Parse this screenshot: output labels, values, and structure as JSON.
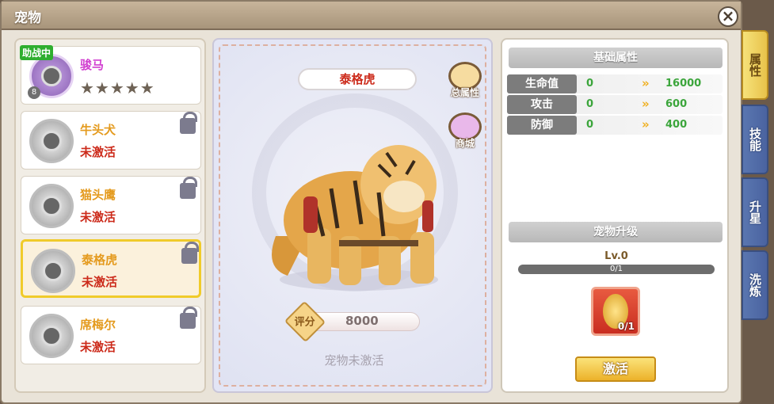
{
  "window": {
    "title": "宠物"
  },
  "pets": [
    {
      "name": "骏马",
      "state": "",
      "active": true,
      "assist_badge": "助战中",
      "level": "8",
      "stars": "★★★★★",
      "locked": false
    },
    {
      "name": "牛头犬",
      "state": "未激活",
      "active": false,
      "locked": true
    },
    {
      "name": "猫头鹰",
      "state": "未激活",
      "active": false,
      "locked": true
    },
    {
      "name": "泰格虎",
      "state": "未激活",
      "active": false,
      "locked": true,
      "selected": true
    },
    {
      "name": "席梅尔",
      "state": "未激活",
      "active": false,
      "locked": true
    }
  ],
  "center": {
    "pet_name": "泰格虎",
    "total_attr_label": "总属性",
    "shop_label": "商城",
    "score_label": "评分",
    "score_value": "8000",
    "inactive_text": "宠物未激活"
  },
  "base_attrs": {
    "header": "基础属性",
    "rows": [
      {
        "name": "生命值",
        "current": "0",
        "next": "16000"
      },
      {
        "name": "攻击",
        "current": "0",
        "next": "600"
      },
      {
        "name": "防御",
        "current": "0",
        "next": "400"
      }
    ]
  },
  "upgrade": {
    "header": "宠物升级",
    "level": "Lv.0",
    "exp_text": "0/1",
    "item_count": "0/1",
    "activate_label": "激活"
  },
  "side_tabs": [
    "属性",
    "技能",
    "升星",
    "洗炼"
  ],
  "colors": {
    "selected_border": "#f0cb2a",
    "inactive_red": "#cc2a1a",
    "value_green": "#3ba53b",
    "tab_blue": "#4a63a0"
  }
}
